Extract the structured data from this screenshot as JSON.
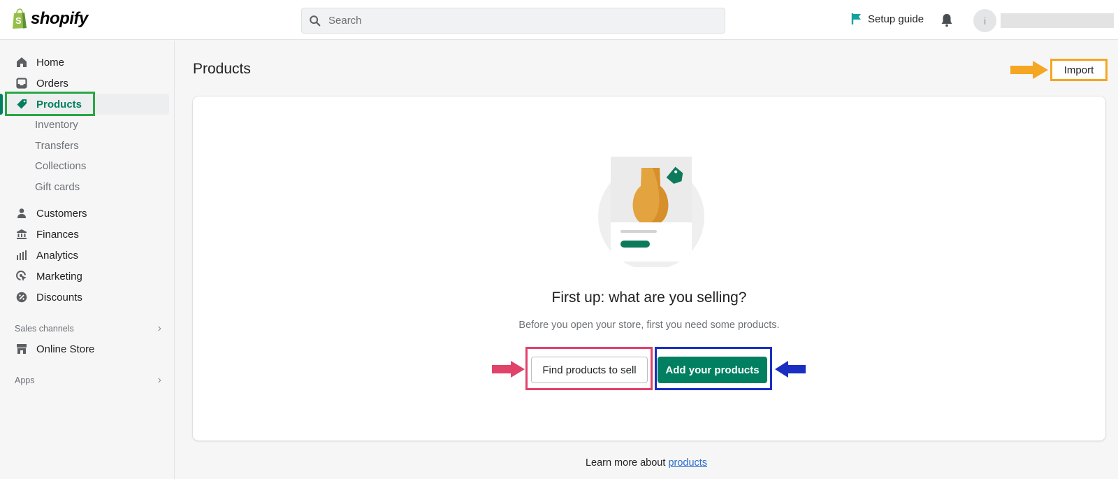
{
  "app": {
    "brand": "shopify",
    "colors": {
      "accent": "#008060",
      "link": "#2c6ecb",
      "highlight_green": "#28a745",
      "highlight_orange": "#f5a623",
      "highlight_pink": "#e0426a",
      "highlight_blue": "#1a2fc2"
    }
  },
  "topbar": {
    "search": {
      "placeholder": "Search",
      "value": "",
      "icon": "search-icon"
    },
    "setup_guide": {
      "label": "Setup guide",
      "icon": "flag-icon"
    },
    "notifications": {
      "icon": "bell-icon"
    },
    "avatar": {
      "initial": "i"
    }
  },
  "sidebar": {
    "items": [
      {
        "label": "Home",
        "icon": "home-icon"
      },
      {
        "label": "Orders",
        "icon": "orders-icon"
      },
      {
        "label": "Products",
        "icon": "tag-icon",
        "active": true
      },
      {
        "label": "Customers",
        "icon": "person-icon"
      },
      {
        "label": "Finances",
        "icon": "bank-icon"
      },
      {
        "label": "Analytics",
        "icon": "bar-chart-icon"
      },
      {
        "label": "Marketing",
        "icon": "target-icon"
      },
      {
        "label": "Discounts",
        "icon": "discount-icon"
      }
    ],
    "product_subitems": [
      {
        "label": "Inventory"
      },
      {
        "label": "Transfers"
      },
      {
        "label": "Collections"
      },
      {
        "label": "Gift cards"
      }
    ],
    "sales_channels": {
      "label": "Sales channels",
      "items": [
        {
          "label": "Online Store",
          "icon": "store-icon"
        }
      ]
    },
    "apps": {
      "label": "Apps"
    }
  },
  "main": {
    "title": "Products",
    "import_label": "Import",
    "empty_state": {
      "heading": "First up: what are you selling?",
      "description": "Before you open your store, first you need some products.",
      "secondary_action": "Find products to sell",
      "primary_action": "Add your products"
    },
    "footer": {
      "prefix": "Learn more about ",
      "link": "products"
    }
  }
}
